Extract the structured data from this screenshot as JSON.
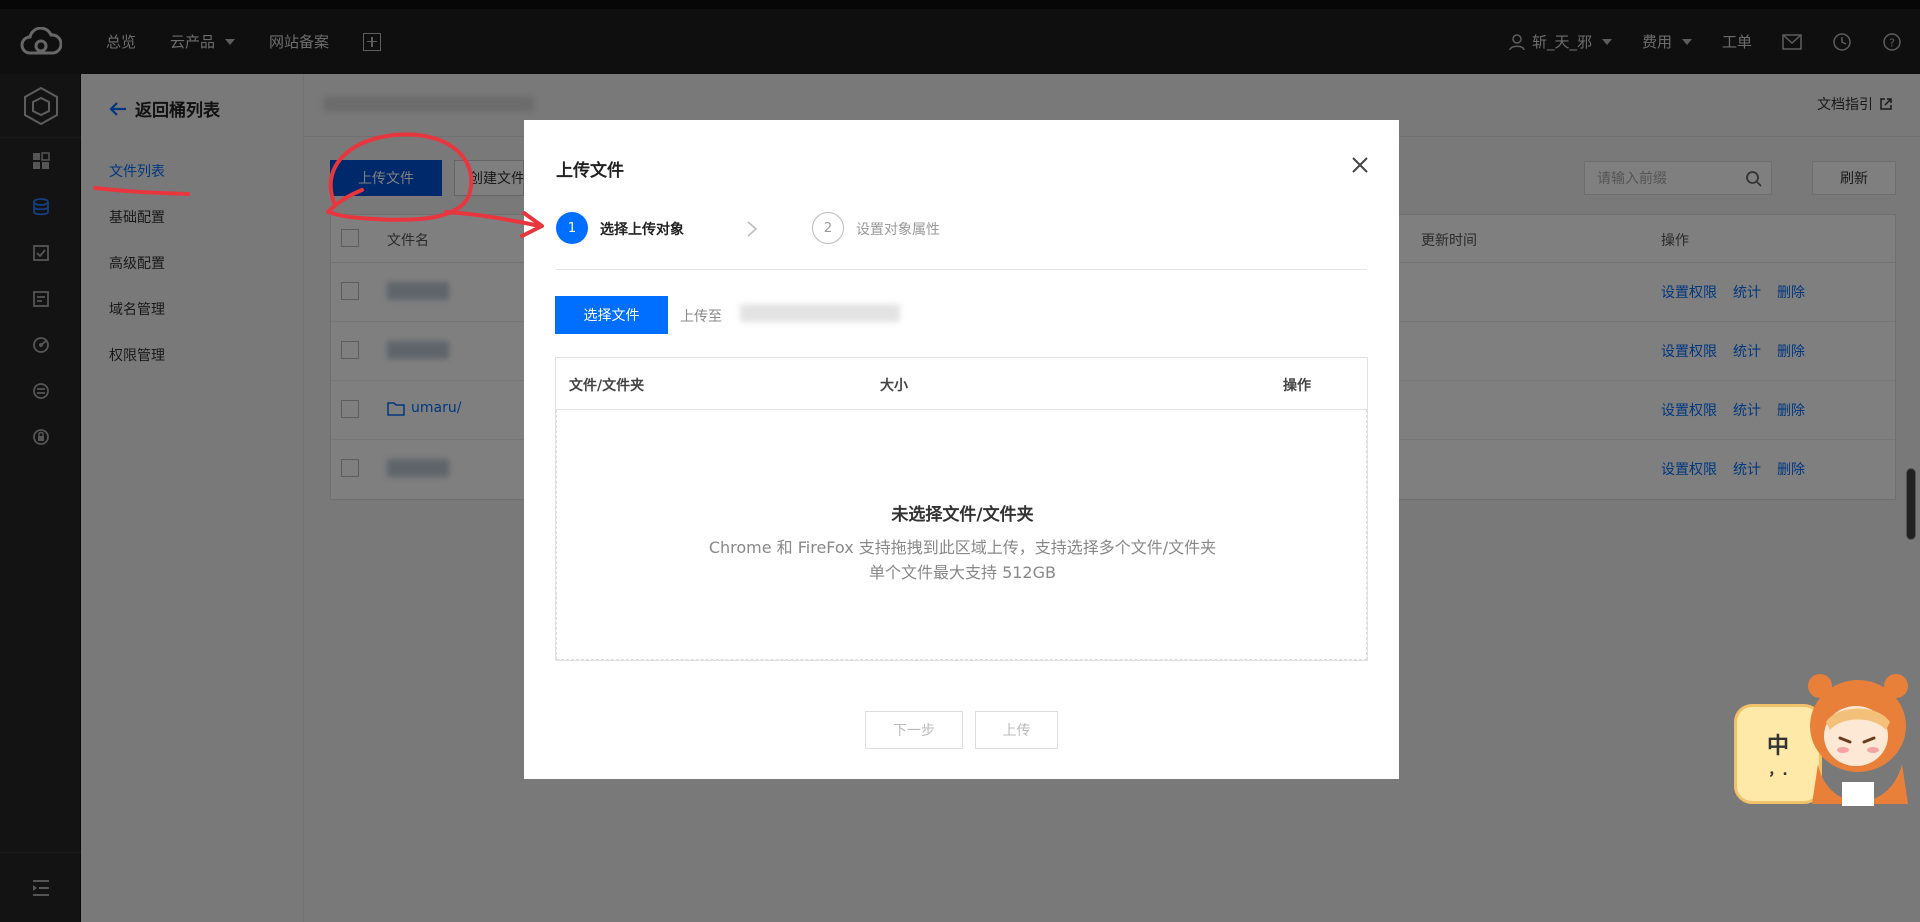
{
  "topnav": {
    "overview": "总览",
    "cloud_products": "云产品",
    "icp": "网站备案",
    "user": "斩_天_邪",
    "billing": "费用",
    "ticket": "工单"
  },
  "sidebar": {
    "back_label": "返回桶列表",
    "items": [
      {
        "label": "文件列表"
      },
      {
        "label": "基础配置"
      },
      {
        "label": "高级配置"
      },
      {
        "label": "域名管理"
      },
      {
        "label": "权限管理"
      }
    ]
  },
  "main": {
    "doc_guide": "文档指引",
    "upload_button": "上传文件",
    "create_button": "创建文件夹",
    "search_placeholder": "请输入前缀",
    "refresh_button": "刷新",
    "table": {
      "col_name": "文件名",
      "col_time": "更新时间",
      "col_ops": "操作",
      "rows": [
        {
          "name": "",
          "ops": [
            "设置权限",
            "统计",
            "删除"
          ]
        },
        {
          "name": "",
          "ops": [
            "设置权限",
            "统计",
            "删除"
          ]
        },
        {
          "name": "umaru/",
          "ops": [
            "设置权限",
            "统计",
            "删除"
          ]
        },
        {
          "name": "",
          "ops": [
            "设置权限",
            "统计",
            "删除"
          ]
        }
      ]
    }
  },
  "modal": {
    "title": "上传文件",
    "step1_num": "1",
    "step1_label": "选择上传对象",
    "step2_num": "2",
    "step2_label": "设置对象属性",
    "select_file_button": "选择文件",
    "upload_to_label": "上传至",
    "table": {
      "col_file": "文件/文件夹",
      "col_size": "大小",
      "col_ops": "操作"
    },
    "empty_title": "未选择文件/文件夹",
    "empty_line1": "Chrome 和 FireFox 支持拖拽到此区域上传，支持选择多个文件/文件夹",
    "empty_line2": "单个文件最大支持 512GB",
    "next_button": "下一步",
    "upload_button": "上传"
  },
  "mascot": {
    "bubble_text": "中",
    "bubble_sub": "，."
  },
  "colors": {
    "primary": "#006eff",
    "primary_dark": "#0052d9",
    "annotation_red": "#e8363e",
    "topbar": "#1f1f1f"
  }
}
